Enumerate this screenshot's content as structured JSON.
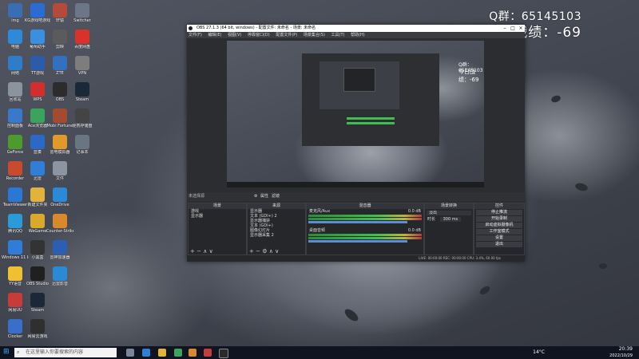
{
  "overlay": {
    "qq_line": "Q群：65145103",
    "score_line": "今日战绩：-69"
  },
  "desktop_icons": [
    {
      "label": "img",
      "color": "#3b6db3"
    },
    {
      "label": "KG游戏吧游戏",
      "color": "#2b6cd4"
    },
    {
      "label": "轩辕",
      "color": "#b34a3b"
    },
    {
      "label": "Switcher",
      "color": "#6c7686"
    },
    {
      "label": "电脑",
      "color": "#2e8ad8"
    },
    {
      "label": "葡萄助手",
      "color": "#3a8fe0"
    },
    {
      "label": "剪映",
      "color": "#5b5b5b"
    },
    {
      "label": "百度网盘",
      "color": "#d8322b"
    },
    {
      "label": "网络",
      "color": "#2f7dc8"
    },
    {
      "label": "TT游戏",
      "color": "#2a5caa"
    },
    {
      "label": "ZTE",
      "color": "#3470c0"
    },
    {
      "label": "VPN",
      "color": "#7d7d7d"
    },
    {
      "label": "回收站",
      "color": "#8b939c"
    },
    {
      "label": "WPS",
      "color": "#d12f2f"
    },
    {
      "label": "OBS",
      "color": "#2c2c2c"
    },
    {
      "label": "Steam",
      "color": "#1b2838"
    },
    {
      "label": "控制面板",
      "color": "#3a78c9"
    },
    {
      "label": "Ace浏览器",
      "color": "#3aa35c"
    },
    {
      "label": "Mobi Fortune",
      "color": "#a34b2f"
    },
    {
      "label": "便携存储盘",
      "color": "#444"
    },
    {
      "label": "GeForce",
      "color": "#4d9b2f"
    },
    {
      "label": "蓝奏",
      "color": "#2a69c8"
    },
    {
      "label": "雷电模拟器",
      "color": "#e09a2b"
    },
    {
      "label": "记事本",
      "color": "#6a7582"
    },
    {
      "label": "Recorder",
      "color": "#c84a2f"
    },
    {
      "label": "迅雷",
      "color": "#2f7fd8"
    },
    {
      "label": "文件",
      "color": "#8c96a3"
    },
    {
      "label": "",
      "color": "#000"
    },
    {
      "label": "TeamViewer",
      "color": "#2b77d4"
    },
    {
      "label": "新建文件夹",
      "color": "#e0b33a"
    },
    {
      "label": "OneDrive",
      "color": "#2a8ad8"
    },
    {
      "label": "",
      "color": "#000"
    },
    {
      "label": "腾讯QQ",
      "color": "#2a9ad8"
    },
    {
      "label": "WeGame",
      "color": "#d8a92b"
    },
    {
      "label": "Counter-Strike Global Off",
      "color": "#d8892b"
    },
    {
      "label": "",
      "color": "#000"
    },
    {
      "label": "Windows 11 Installation",
      "color": "#2f7dd8"
    },
    {
      "label": "小黑盒",
      "color": "#333"
    },
    {
      "label": "雷神加速器",
      "color": "#2b5fb3"
    },
    {
      "label": "",
      "color": "#000"
    },
    {
      "label": "YY语音",
      "color": "#f0c030"
    },
    {
      "label": "OBS Studio",
      "color": "#202020"
    },
    {
      "label": "迅雷影音",
      "color": "#2a8ad8"
    },
    {
      "label": "",
      "color": "#000"
    },
    {
      "label": "网易UU",
      "color": "#c73b3b"
    },
    {
      "label": "Steam",
      "color": "#1b2838"
    },
    {
      "label": "",
      "color": "#000"
    },
    {
      "label": "",
      "color": "#000"
    },
    {
      "label": "Clocker",
      "color": "#3a6fc9"
    },
    {
      "label": "网易云游戏",
      "color": "#2f2f2f"
    }
  ],
  "obs": {
    "title": "OBS 27.1.3 (64 bit, windows) - 配置文件: 未命名 - 场景: 未命名",
    "menu": [
      "文件(F)",
      "编辑(E)",
      "视图(V)",
      "停靠窗口(D)",
      "配置文件(P)",
      "场景集合(S)",
      "工具(T)",
      "帮助(H)"
    ],
    "scene_label": "未选择源",
    "scene_buttons": [
      "属性",
      "滤镜"
    ],
    "docks": {
      "scenes": {
        "title": "场景",
        "items": [
          "游戏",
          "显示器"
        ]
      },
      "sources": {
        "title": "来源",
        "items": [
          "显示器",
          "文本 (GDI+) 2",
          "显示器捕获",
          "文本 (GDI+)",
          "图像幻灯片",
          "显示器采集 2"
        ]
      },
      "mixer": {
        "title": "混音器",
        "tracks": [
          {
            "name": "麦克风/Aux",
            "db": "0.0 dB"
          },
          {
            "name": "桌面音频",
            "db": "0.0 dB"
          }
        ]
      },
      "transitions": {
        "title": "场景转换",
        "type": "淡出",
        "duration_label": "时长",
        "duration": "300 ms"
      },
      "controls": {
        "title": "控件",
        "buttons": [
          "停止推流",
          "开始录制",
          "启动虚拟摄像机",
          "工作室模式",
          "设置",
          "退出"
        ]
      }
    },
    "status": "LIVE: 00:00:00   REC: 00:00:00   CPU: 3.4%, 60.00 fps",
    "preview_overlay": {
      "qq_line": "Q群：65145103",
      "score_line": "今日战绩：-69"
    }
  },
  "taskbar": {
    "search_placeholder": "在这里输入你要搜索的内容",
    "weather": "14°C",
    "time": "20:39",
    "date": "2022/10/29"
  }
}
